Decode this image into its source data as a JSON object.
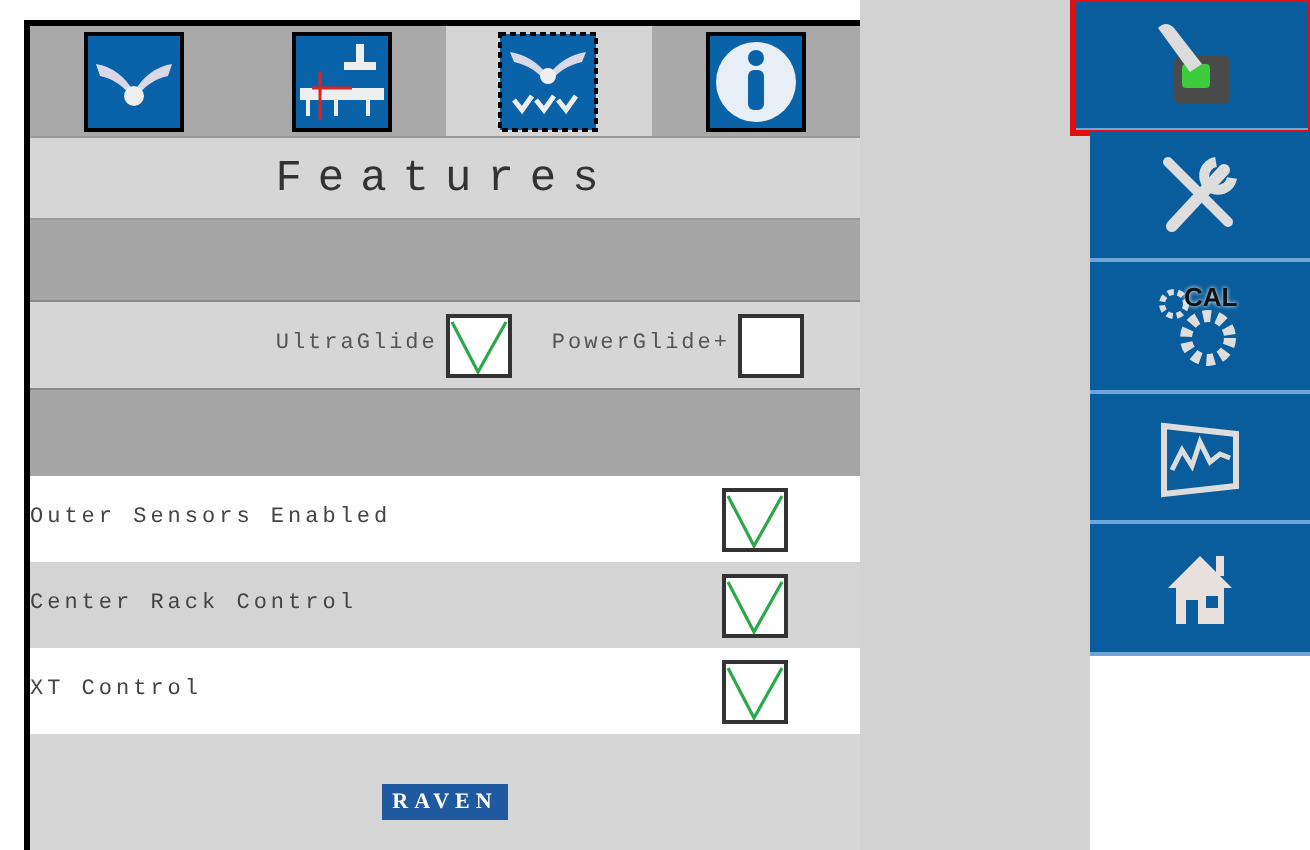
{
  "tabs": [
    {
      "selected": false
    },
    {
      "selected": false
    },
    {
      "selected": true
    },
    {
      "selected": false
    }
  ],
  "header": {
    "title": "Features"
  },
  "glide_options": [
    {
      "label": "UltraGlide",
      "checked": true
    },
    {
      "label": "PowerGlide+",
      "checked": false
    }
  ],
  "features": [
    {
      "label": "Outer Sensors Enabled",
      "checked": true
    },
    {
      "label": "Center Rack Control",
      "checked": true
    },
    {
      "label": "XT Control",
      "checked": true
    }
  ],
  "logo": "RAVEN",
  "sidebar": [
    {
      "highlighted": true
    },
    {
      "highlighted": false
    },
    {
      "highlighted": false,
      "text": "CAL"
    },
    {
      "highlighted": false
    },
    {
      "highlighted": false
    }
  ]
}
